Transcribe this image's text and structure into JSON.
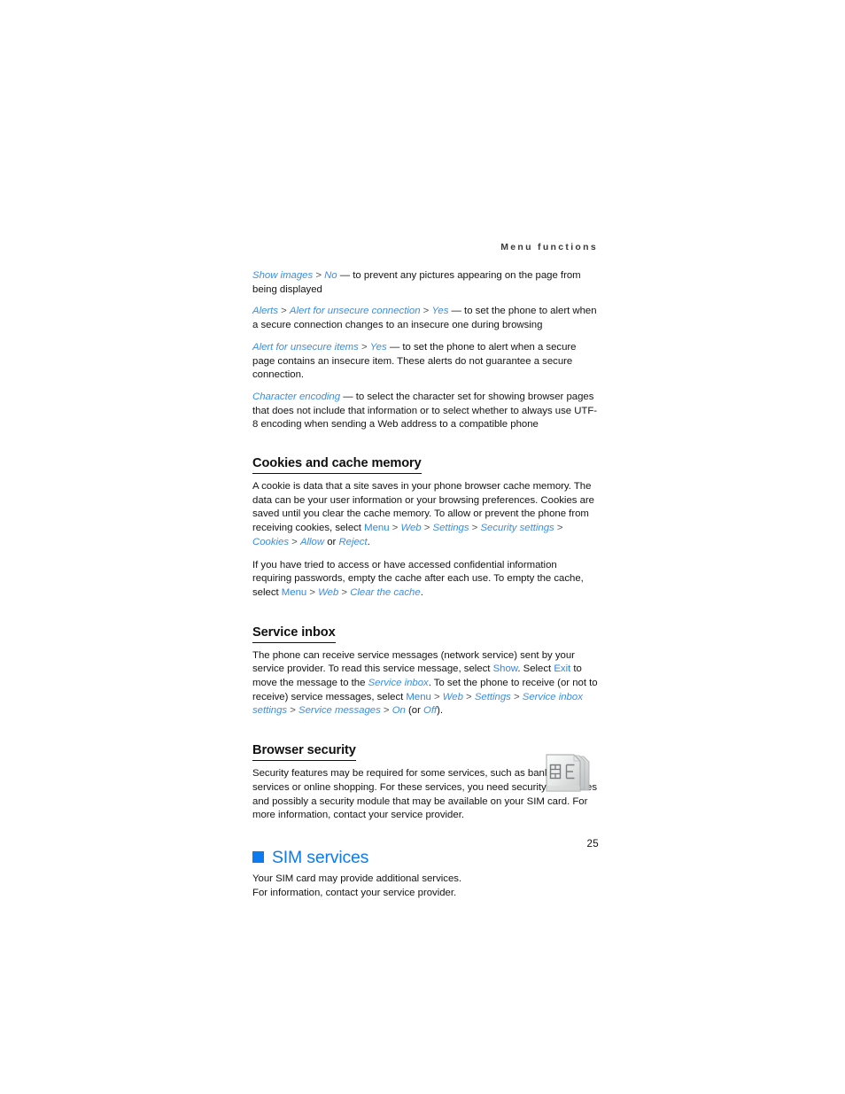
{
  "page": {
    "running_head": "Menu functions",
    "folio": "25"
  },
  "settings_list": {
    "items": [
      {
        "id": "show-images",
        "segments": [
          {
            "t": "Show images",
            "s": "ref"
          },
          {
            "t": " > ",
            "s": "sep"
          },
          {
            "t": "No",
            "s": "ref"
          },
          {
            "t": " — to prevent any pictures appearing on the page from being displayed",
            "s": "plain"
          }
        ]
      },
      {
        "id": "alerts",
        "segments": [
          {
            "t": "Alerts",
            "s": "ref"
          },
          {
            "t": " > ",
            "s": "sep"
          },
          {
            "t": "Alert for unsecure connection",
            "s": "ref"
          },
          {
            "t": " > ",
            "s": "sep"
          },
          {
            "t": "Yes",
            "s": "ref"
          },
          {
            "t": " — to set the phone to alert when a secure connection changes to an insecure one during browsing",
            "s": "plain"
          }
        ]
      },
      {
        "id": "alert-unsecure-items",
        "segments": [
          {
            "t": "Alert for unsecure items",
            "s": "ref"
          },
          {
            "t": " > ",
            "s": "sep"
          },
          {
            "t": "Yes",
            "s": "ref"
          },
          {
            "t": " — to set the phone to alert when a secure page contains an insecure item. These alerts do not guarantee a secure connection.",
            "s": "plain"
          }
        ]
      },
      {
        "id": "character-encoding",
        "segments": [
          {
            "t": "Character encoding",
            "s": "ref"
          },
          {
            "t": " — to select the character set for showing browser pages that does not include that information or to select whether to always use UTF-8 encoding when sending a Web address to a compatible phone",
            "s": "plain"
          }
        ]
      }
    ]
  },
  "cookies_section": {
    "heading": "Cookies and cache memory",
    "paragraphs": [
      {
        "id": "cookies-definition",
        "segments": [
          {
            "t": "A cookie is data that a site saves in your phone browser cache memory. The data can be your user information or your browsing preferences. Cookies are saved until you clear the cache memory. To allow or prevent the phone from receiving cookies, select ",
            "s": "plain"
          },
          {
            "t": "Menu",
            "s": "cmd"
          },
          {
            "t": " > ",
            "s": "sep"
          },
          {
            "t": "Web",
            "s": "ref"
          },
          {
            "t": " > ",
            "s": "sep"
          },
          {
            "t": "Settings",
            "s": "ref"
          },
          {
            "t": " > ",
            "s": "sep"
          },
          {
            "t": "Security settings",
            "s": "ref"
          },
          {
            "t": " > ",
            "s": "sep"
          },
          {
            "t": "Cookies",
            "s": "ref"
          },
          {
            "t": " > ",
            "s": "sep"
          },
          {
            "t": "Allow",
            "s": "ref"
          },
          {
            "t": " or ",
            "s": "plain"
          },
          {
            "t": "Reject",
            "s": "ref"
          },
          {
            "t": ".",
            "s": "plain"
          }
        ]
      },
      {
        "id": "empty-cache",
        "segments": [
          {
            "t": "If you have tried to access or have accessed confidential information requiring passwords, empty the cache after each use. To empty the cache, select ",
            "s": "plain"
          },
          {
            "t": "Menu",
            "s": "cmd"
          },
          {
            "t": " > ",
            "s": "sep"
          },
          {
            "t": "Web",
            "s": "ref"
          },
          {
            "t": " > ",
            "s": "sep"
          },
          {
            "t": "Clear the cache",
            "s": "ref"
          },
          {
            "t": ".",
            "s": "plain"
          }
        ]
      }
    ]
  },
  "service_inbox_section": {
    "heading": "Service inbox",
    "paragraphs": [
      {
        "id": "service-inbox-body",
        "segments": [
          {
            "t": "The phone can receive service messages (network service) sent by your service provider. To read this service message, select ",
            "s": "plain"
          },
          {
            "t": "Show",
            "s": "cmd"
          },
          {
            "t": ". Select ",
            "s": "plain"
          },
          {
            "t": "Exit",
            "s": "cmd"
          },
          {
            "t": " to move the message to the ",
            "s": "plain"
          },
          {
            "t": "Service inbox",
            "s": "ref"
          },
          {
            "t": ". To set the phone to receive (or not to receive) service messages, select ",
            "s": "plain"
          },
          {
            "t": "Menu",
            "s": "cmd"
          },
          {
            "t": " > ",
            "s": "sep"
          },
          {
            "t": "Web",
            "s": "ref"
          },
          {
            "t": " > ",
            "s": "sep"
          },
          {
            "t": "Settings",
            "s": "ref"
          },
          {
            "t": " > ",
            "s": "sep"
          },
          {
            "t": "Service inbox settings",
            "s": "ref"
          },
          {
            "t": " > ",
            "s": "sep"
          },
          {
            "t": "Service messages",
            "s": "ref"
          },
          {
            "t": " > ",
            "s": "sep"
          },
          {
            "t": "On",
            "s": "ref"
          },
          {
            "t": " (or ",
            "s": "plain"
          },
          {
            "t": "Off",
            "s": "ref"
          },
          {
            "t": ").",
            "s": "plain"
          }
        ]
      }
    ]
  },
  "browser_security_section": {
    "heading": "Browser security",
    "paragraphs": [
      {
        "id": "browser-security-body",
        "segments": [
          {
            "t": "Security features may be required for some services, such as banking services or online shopping. For these services, you need security certificates and possibly a security module that may be available on your SIM card. For more information, contact your service provider.",
            "s": "plain"
          }
        ]
      }
    ]
  },
  "sim_services_section": {
    "heading": "SIM services",
    "bullet_color": "#0d7bef",
    "icon": "sim-card-stack-icon",
    "paragraphs": [
      {
        "id": "sim-services-body",
        "segments": [
          {
            "t": "Your SIM card may provide additional services.\nFor information, contact your service provider.",
            "s": "plain"
          }
        ]
      }
    ]
  }
}
